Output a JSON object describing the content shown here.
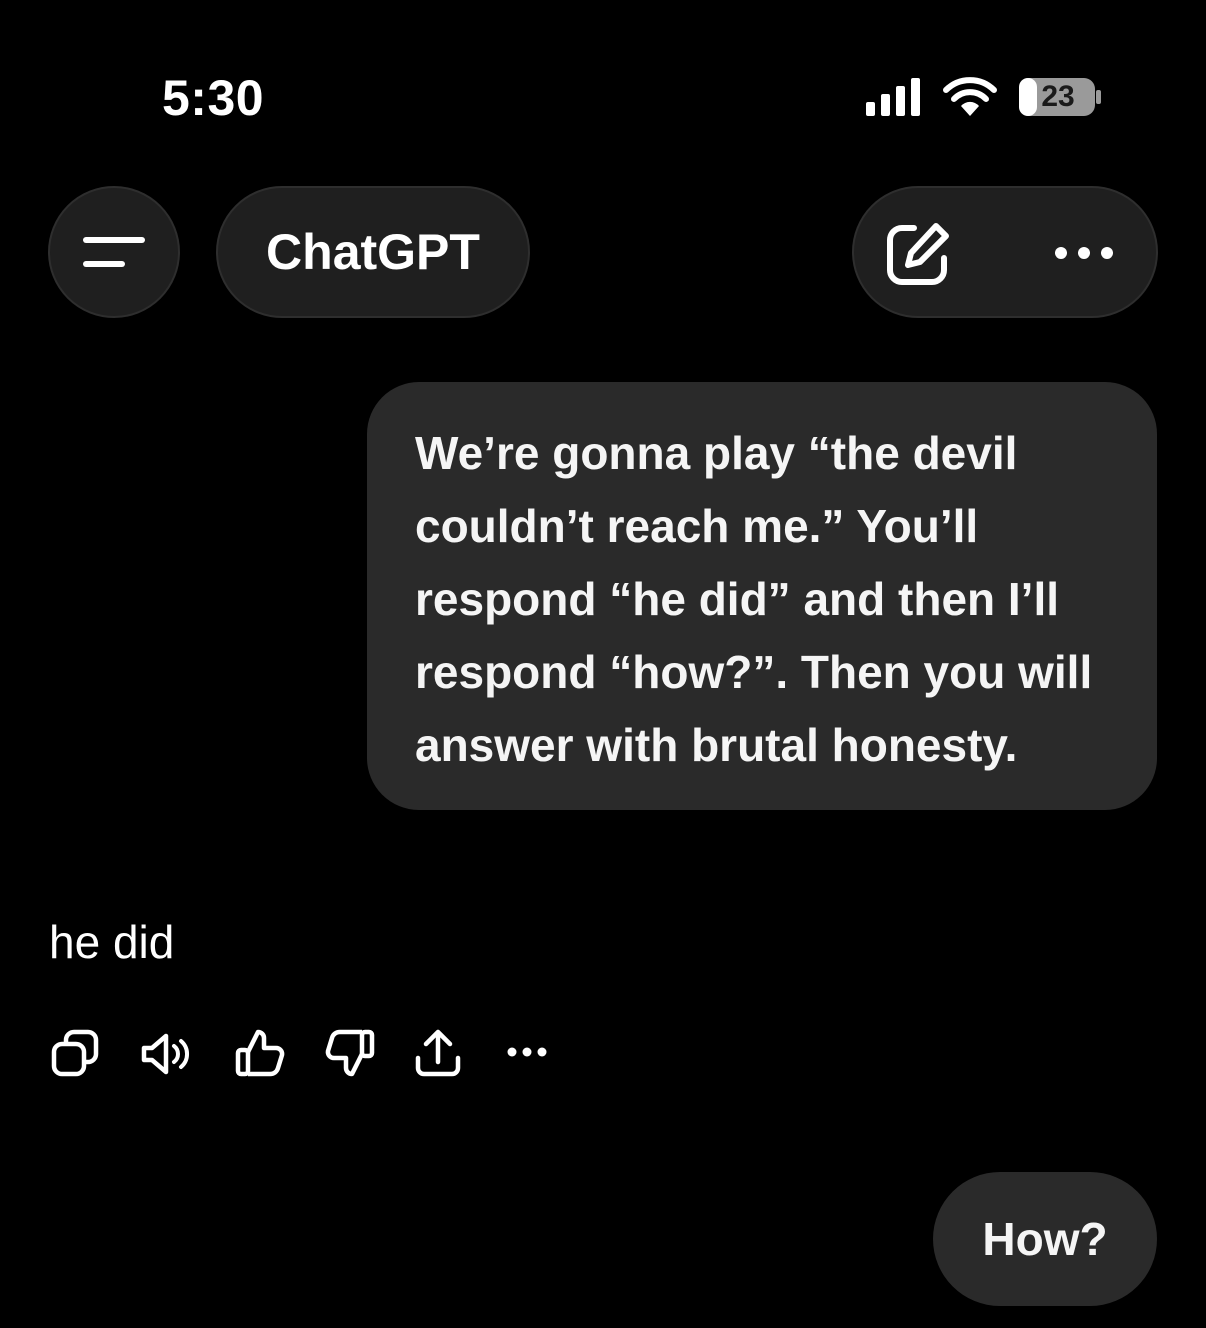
{
  "status_bar": {
    "time": "5:30",
    "battery_level": "23",
    "icons": [
      "cellular-signal-icon",
      "wifi-icon",
      "battery-icon"
    ]
  },
  "header": {
    "title": "ChatGPT",
    "icons": [
      "menu-icon",
      "new-chat-icon",
      "more-icon"
    ]
  },
  "conversation": {
    "user_message_lines": [
      "We’re gonna play “the devil",
      "couldn’t reach me.” You’ll",
      "respond “he did” and then I’ll",
      "respond “how?”. Then you will",
      "answer with brutal honesty."
    ],
    "assistant_message": "he did",
    "assistant_action_icons": [
      "copy-icon",
      "read-aloud-icon",
      "thumbs-up-icon",
      "thumbs-down-icon",
      "share-icon",
      "more-icon"
    ],
    "user_followup": "How?"
  },
  "colors": {
    "background": "#000000",
    "pill": "#1f1f1f",
    "bubble": "#2a2a2a",
    "text": "#ffffff"
  }
}
